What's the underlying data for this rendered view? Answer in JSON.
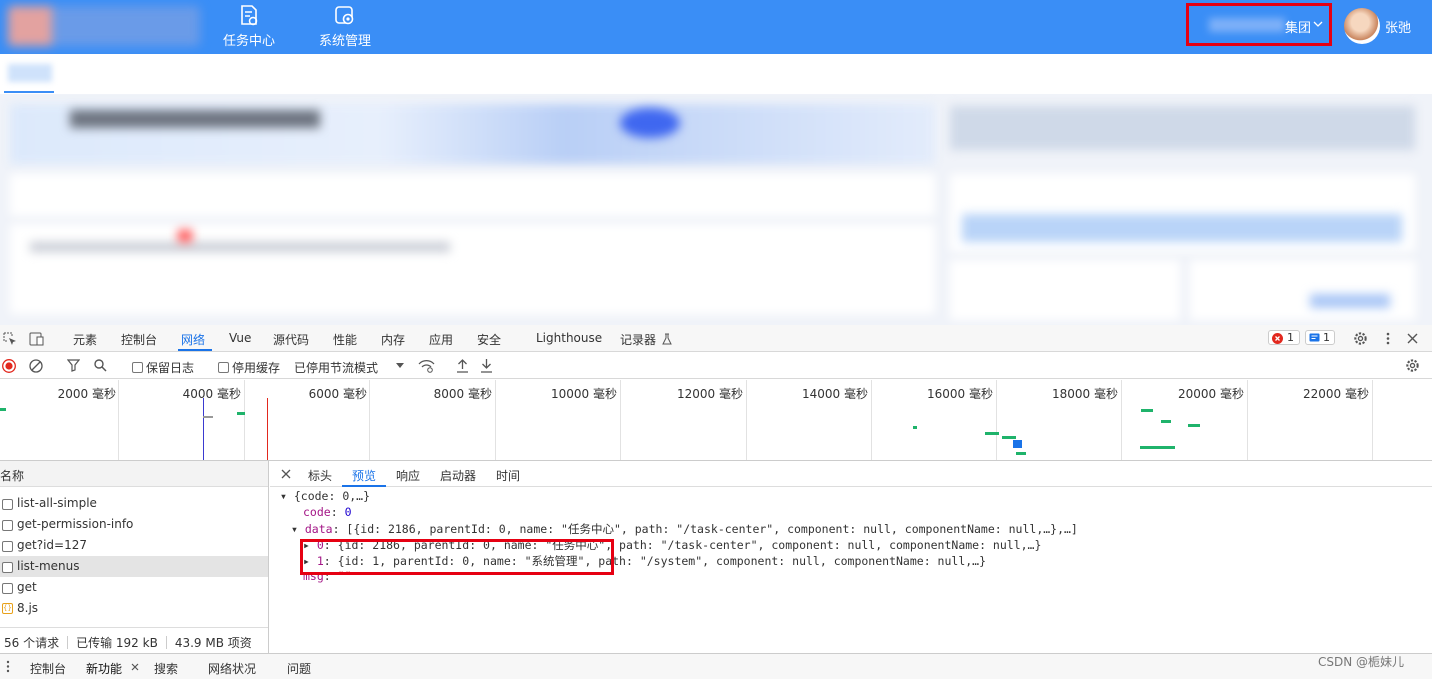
{
  "topbar": {
    "nav": [
      {
        "label": "任务中心",
        "icon": "task-doc-icon"
      },
      {
        "label": "系统管理",
        "icon": "system-settings-icon"
      }
    ],
    "org_label": "集团",
    "user_name": "张弛",
    "colors": {
      "bar": "#3a8ef6",
      "highlight": "#e60012"
    }
  },
  "devtools": {
    "tabs": [
      "元素",
      "控制台",
      "网络",
      "Vue",
      "源代码",
      "性能",
      "内存",
      "应用",
      "安全",
      "Lighthouse",
      "记录器 "
    ],
    "active_tab": "网络",
    "error_count": "1",
    "message_count": "1",
    "toolbar": {
      "preserve_log": "保留日志",
      "disable_cache": "停用缓存",
      "throttle": "已停用节流模式"
    },
    "timeline_labels": [
      "2000 毫秒",
      "4000 毫秒",
      "6000 毫秒",
      "8000 毫秒",
      "10000 毫秒",
      "12000 毫秒",
      "14000 毫秒",
      "16000 毫秒",
      "18000 毫秒",
      "20000 毫秒",
      "22000 毫秒"
    ],
    "request_list": {
      "header": "名称",
      "items": [
        "list-all-simple",
        "get-permission-info",
        "get?id=127",
        "list-menus",
        "get",
        "8.js"
      ],
      "selected": "list-menus",
      "summary": {
        "requests": "56 个请求",
        "transferred": "已传输 192 kB",
        "resources": "43.9 MB 项资源"
      }
    },
    "detail_tabs": [
      "标头",
      "预览",
      "响应",
      "启动器",
      "时间"
    ],
    "active_detail_tab": "预览",
    "preview": {
      "root": "{code: 0,…}",
      "code_key": "code",
      "code_val": "0",
      "data_key": "data",
      "data_summary": "[{id: 2186, parentId: 0, name: \"任务中心\", path: \"/task-center\", component: null, componentName: null,…},…]",
      "item0_key": "0",
      "item0": "{id: 2186, parentId: 0, name: \"任务中心\", path: \"/task-center\", component: null, componentName: null,…}",
      "item1_key": "1",
      "item1": "{id: 1, parentId: 0, name: \"系统管理\", path: \"/system\", component: null, componentName: null,…}",
      "msg_key": "msg",
      "msg_val": "\"\""
    },
    "drawer_tabs": [
      "控制台",
      "新功能",
      "搜索",
      "网络状况",
      "问题"
    ]
  },
  "watermark": "CSDN @栀妹儿"
}
